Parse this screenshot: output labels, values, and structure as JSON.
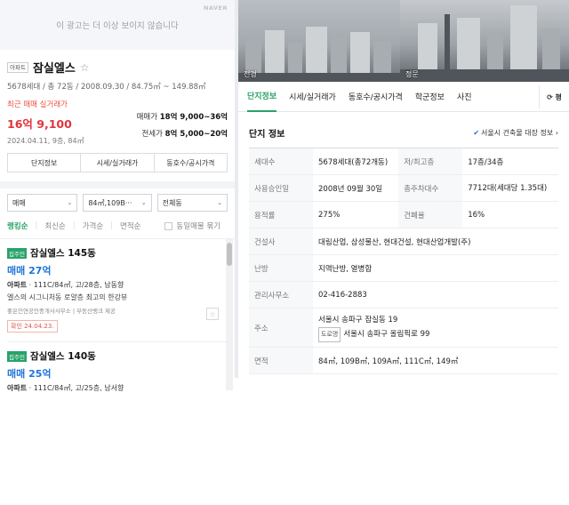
{
  "ad": {
    "text": "이 광고는 더 이상 보이지 않습니다",
    "brand": "NAVER"
  },
  "complex": {
    "type_badge": "아파트",
    "name": "잠실엘스",
    "summary": "5678세대 / 총 72동 / 2008.09.30 / 84.75㎡ ~ 149.88㎡",
    "recent_label": "최근 매매 실거래가",
    "recent_price": "16억 9,100",
    "recent_date": "2024.04.11, 9층, 84㎡",
    "sale_range_label": "매매가",
    "sale_range": "18억 9,000~36억",
    "lease_range_label": "전세가",
    "lease_range": "8억 5,000~20억",
    "buttons": [
      "단지정보",
      "시세/실거래가",
      "동호수/공시가격"
    ]
  },
  "filters": {
    "trade": "매매",
    "area": "84㎡,109B···",
    "dong": "전체동"
  },
  "sorts": {
    "items": [
      "랭킹순",
      "최신순",
      "가격순",
      "면적순"
    ],
    "same_listing": "동일매물 묶기"
  },
  "listings": [
    {
      "badge": "집주인",
      "name": "잠실엘스 145동",
      "price": "매매 27억",
      "spec_type": "아파트",
      "spec": " · 111C/84㎡, 고/28층, 남동향",
      "desc": "엘스의 시그니처동 로얄층 최고의 한강뷰",
      "source": "좋은인연공인중개사사무소  |  부동산뱅크 제공",
      "confirm": "확인 24.04.23."
    },
    {
      "badge": "집주인",
      "name": "잠실엘스 140동",
      "price": "매매 25억",
      "spec_type": "아파트",
      "spec": " · 111C/84㎡, 고/25층, 남서향"
    }
  ],
  "photos": [
    {
      "caption": "전경"
    },
    {
      "caption": "정문"
    }
  ],
  "tabs": [
    "단지정보",
    "시세/실거래가",
    "동호수/공시가격",
    "학군정보",
    "사진"
  ],
  "refresh_label": "⟳ 평",
  "info": {
    "title": "단지 정보",
    "seoul_link": "서울시 건축물 대장 정보 ›",
    "rows": {
      "households_k": "세대수",
      "households_v": "5678세대(총72개동)",
      "floors_k": "저/최고층",
      "floors_v": "17층/34층",
      "approval_k": "사용승인일",
      "approval_v": "2008년 09월 30일",
      "parking_k": "총주차대수",
      "parking_v": "7712대(세대당 1.35대)",
      "far_k": "용적률",
      "far_v": "275%",
      "bcr_k": "건폐율",
      "bcr_v": "16%",
      "builder_k": "건설사",
      "builder_v": "대림산업, 삼성물산, 현대건설, 현대산업개발(주)",
      "heating_k": "난방",
      "heating_v": "지역난방, 열병합",
      "office_k": "관리사무소",
      "office_v": "02-416-2883",
      "address_k": "주소",
      "address_v": "서울시 송파구 잠실동 19",
      "road_tag": "도로명",
      "road_v": "서울시 송파구 올림픽로 99",
      "area_k": "면적",
      "area_v": "84㎡, 109B㎡, 109A㎡, 111C㎡, 149㎡"
    }
  }
}
